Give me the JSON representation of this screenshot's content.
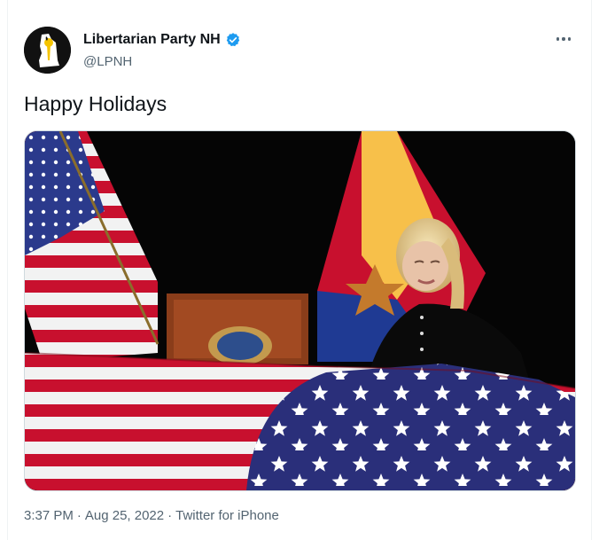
{
  "tweet": {
    "author": {
      "display_name": "Libertarian Party NH",
      "handle": "@LPNH",
      "verified": true,
      "verified_color": "#1d9bf0"
    },
    "text": "Happy Holidays",
    "media": {
      "alt": "Photograph of a mourning woman beside a flag-draped casket with US and Arizona flags behind"
    },
    "meta": {
      "time": "3:37 PM",
      "sep1": "·",
      "date": "Aug 25, 2022",
      "sep2": "·",
      "source": "Twitter for iPhone"
    },
    "icons": {
      "more": "more-horizontal-icon",
      "verified": "verified-badge-icon"
    }
  }
}
